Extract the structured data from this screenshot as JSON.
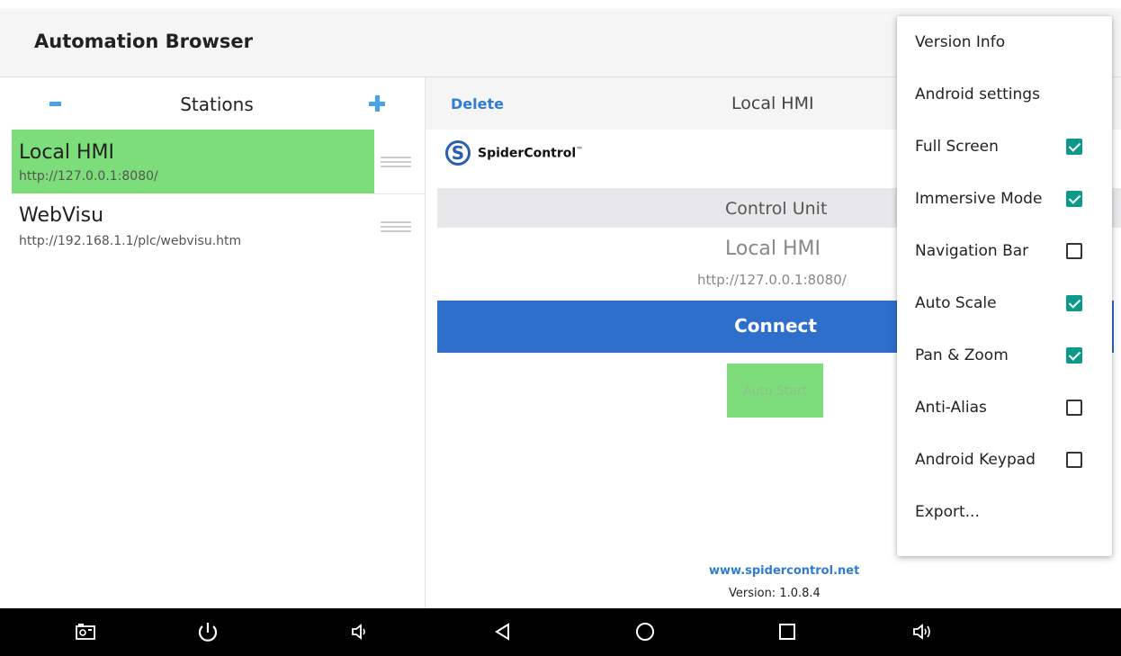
{
  "app": {
    "title": "Automation Browser"
  },
  "stations": {
    "header": "Stations",
    "items": [
      {
        "name": "Local HMI",
        "url": "http://127.0.0.1:8080/",
        "selected": true
      },
      {
        "name": "WebVisu",
        "url": "http://192.168.1.1/plc/webvisu.htm",
        "selected": false
      }
    ]
  },
  "detail": {
    "delete_label": "Delete",
    "title": "Local HMI",
    "logo_text": "SpiderControl",
    "logo_tm": "™",
    "section_label": "Control Unit",
    "unit_name": "Local HMI",
    "unit_url": "http://127.0.0.1:8080/",
    "connect_label": "Connect",
    "auto_start_label": "Auto Start",
    "website": "www.spidercontrol.net",
    "version": "Version: 1.0.8.4"
  },
  "menu": {
    "items": [
      {
        "label": "Version Info",
        "checkbox": null
      },
      {
        "label": "Android settings",
        "checkbox": null
      },
      {
        "label": "Full Screen",
        "checkbox": true
      },
      {
        "label": "Immersive Mode",
        "checkbox": true
      },
      {
        "label": "Navigation Bar",
        "checkbox": false
      },
      {
        "label": "Auto Scale",
        "checkbox": true
      },
      {
        "label": "Pan & Zoom",
        "checkbox": true
      },
      {
        "label": "Anti-Alias",
        "checkbox": false
      },
      {
        "label": "Android Keypad",
        "checkbox": false
      },
      {
        "label": "Export...",
        "checkbox": null
      }
    ]
  },
  "colors": {
    "selection": "#7ddd7a",
    "accent_blue": "#2d6fca",
    "link_blue": "#2f7cd0",
    "checkbox_teal": "#0d9a8a"
  },
  "nav_icons": [
    "screenshot-icon",
    "power-icon",
    "volume-down-icon",
    "back-icon",
    "home-icon",
    "recents-icon",
    "volume-up-icon"
  ]
}
